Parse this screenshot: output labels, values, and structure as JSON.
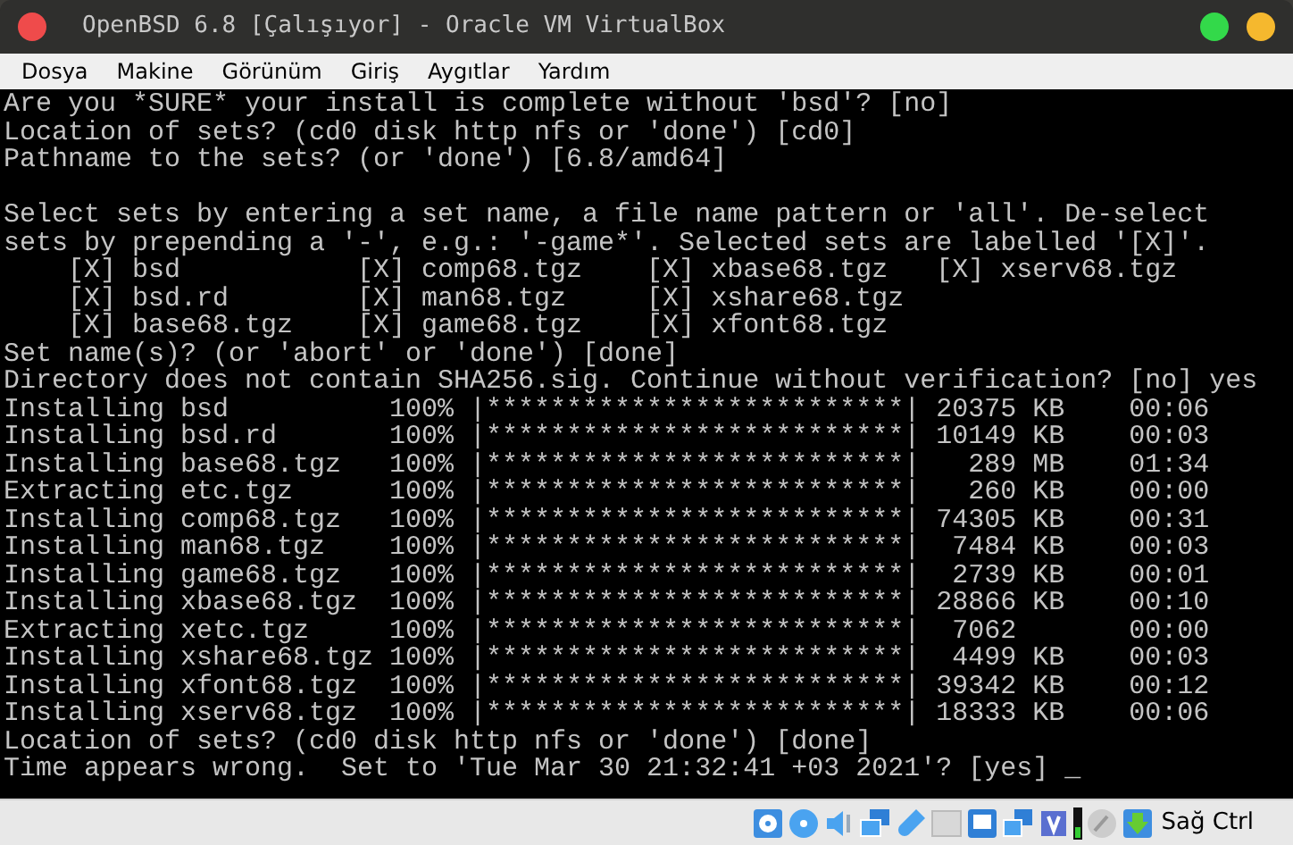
{
  "window": {
    "title": "OpenBSD 6.8 [Çalışıyor] - Oracle VM VirtualBox"
  },
  "menu": [
    "Dosya",
    "Makine",
    "Görünüm",
    "Giriş",
    "Aygıtlar",
    "Yardım"
  ],
  "console": {
    "blocks": [
      [
        "Are you *SURE* your install is complete without 'bsd'? [no]",
        "Location of sets? (cd0 disk http nfs or 'done') [cd0]",
        "Pathname to the sets? (or 'done') [6.8/amd64]"
      ],
      [
        "Select sets by entering a set name, a file name pattern or 'all'. De-select",
        "sets by prepending a '-', e.g.: '-game*'. Selected sets are labelled '[X]'.",
        "    [X] bsd           [X] comp68.tgz    [X] xbase68.tgz   [X] xserv68.tgz",
        "    [X] bsd.rd        [X] man68.tgz     [X] xshare68.tgz",
        "    [X] base68.tgz    [X] game68.tgz    [X] xfont68.tgz",
        "Set name(s)? (or 'abort' or 'done') [done]",
        "Directory does not contain SHA256.sig. Continue without verification? [no] yes",
        "Installing bsd          100% |**************************| 20375 KB    00:06",
        "Installing bsd.rd       100% |**************************| 10149 KB    00:03",
        "Installing base68.tgz   100% |**************************|   289 MB    01:34",
        "Extracting etc.tgz      100% |**************************|   260 KB    00:00",
        "Installing comp68.tgz   100% |**************************| 74305 KB    00:31",
        "Installing man68.tgz    100% |**************************|  7484 KB    00:03",
        "Installing game68.tgz   100% |**************************|  2739 KB    00:01",
        "Installing xbase68.tgz  100% |**************************| 28866 KB    00:10",
        "Extracting xetc.tgz     100% |**************************|  7062       00:00",
        "Installing xshare68.tgz 100% |**************************|  4499 KB    00:03",
        "Installing xfont68.tgz  100% |**************************| 39342 KB    00:12",
        "Installing xserv68.tgz  100% |**************************| 18333 KB    00:06",
        "Location of sets? (cd0 disk http nfs or 'done') [done]",
        "Time appears wrong.  Set to 'Tue Mar 30 21:32:41 +03 2021'? [yes] _"
      ]
    ]
  },
  "status_bar": {
    "host_key": "Sağ Ctrl"
  }
}
